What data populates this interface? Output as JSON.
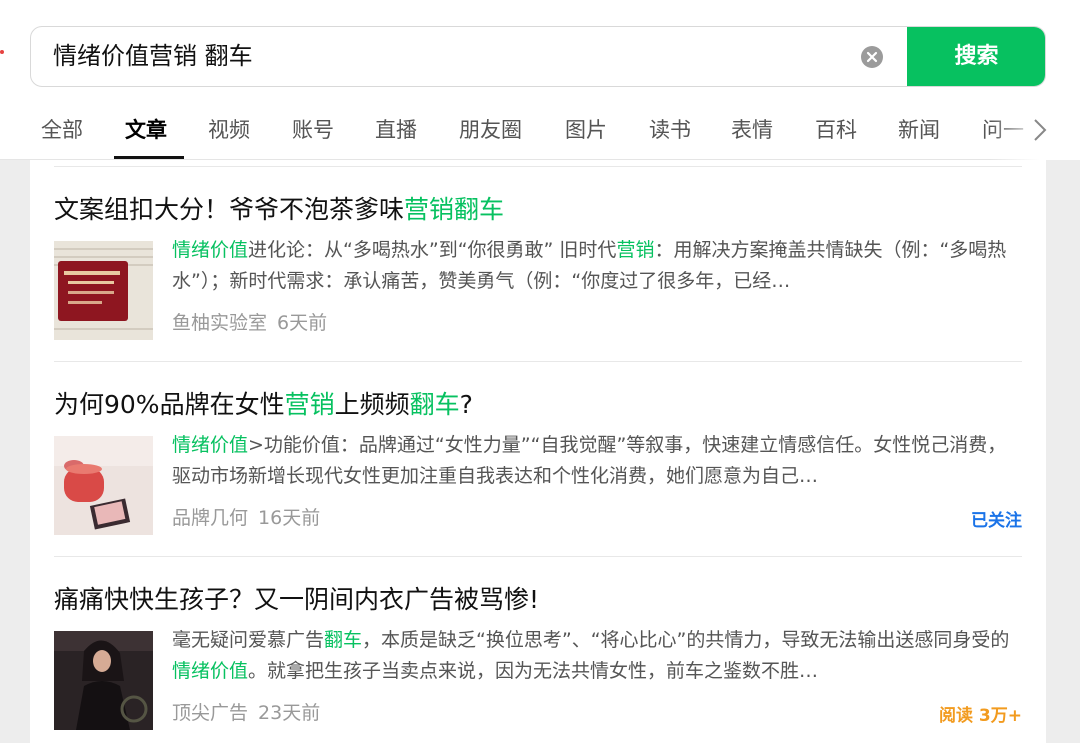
{
  "search": {
    "query": "情绪价值营销 翻车",
    "button_label": "搜索",
    "clear_icon": "clear-circle-icon"
  },
  "tabs": [
    {
      "label": "全部"
    },
    {
      "label": "文章",
      "active": true
    },
    {
      "label": "视频"
    },
    {
      "label": "账号"
    },
    {
      "label": "直播"
    },
    {
      "label": "朋友圈"
    },
    {
      "label": "图片"
    },
    {
      "label": "读书"
    },
    {
      "label": "表情"
    },
    {
      "label": "百科"
    },
    {
      "label": "新闻"
    },
    {
      "label": "问一"
    }
  ],
  "colors": {
    "accent": "#07c160",
    "followed": "#1a73e8",
    "reads": "#f29b1f"
  },
  "results": [
    {
      "title": {
        "pre": "文案组扣大分！爷爷不泡茶爹味",
        "hl": "营销翻车",
        "post": ""
      },
      "summary": {
        "s1_hl": "情绪价值",
        "s2": "进化论：从“多喝热水”到“你很勇敢” 旧时代",
        "s3_hl": "营销",
        "s4": "：用解决方案掩盖共情缺失（例：“多喝热水”）；新时代需求：承认痛苦，赞美勇气（例：“你度过了很多年，已经…"
      },
      "source": "鱼柚实验室",
      "time": "6天前",
      "badge": ""
    },
    {
      "title": {
        "pre": "为何90%品牌在女性",
        "hl": "营销",
        "mid": "上频频",
        "hl2": "翻车",
        "post": "?"
      },
      "summary": {
        "s1_hl": "情绪价值",
        "s2": ">功能价值：品牌通过“女性力量”“自我觉醒”等叙事，快速建立情感信任。女性悦己消费，驱动市场新增长现代女性更加注重自我表达和个性化消费，她们愿意为自己…"
      },
      "source": "品牌几何",
      "time": "16天前",
      "badge": "已关注"
    },
    {
      "title": {
        "pre": "痛痛快快生孩子？又一阴间内衣广告被骂惨!"
      },
      "summary": {
        "s1": "毫无疑问爱慕广告",
        "s2_hl": "翻车",
        "s3": "，本质是缺乏“换位思考”、“将心比心”的共情力，导致无法输出送感同身受的",
        "s4_hl": "情绪价值",
        "s5": "。就拿把生孩子当卖点来说，因为无法共情女性，前车之鉴数不胜…"
      },
      "source": "顶尖广告",
      "time": "23天前",
      "badge": "阅读 3万+"
    }
  ]
}
